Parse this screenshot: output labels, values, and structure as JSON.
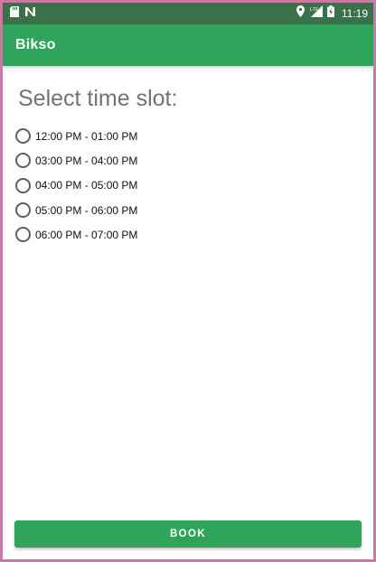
{
  "statusbar": {
    "time": "11:19",
    "network": "LTE",
    "left_icons": [
      "sd-card-icon",
      "n-notification-icon"
    ],
    "right_icons": [
      "location-icon",
      "signal-icon",
      "battery-icon"
    ]
  },
  "appbar": {
    "title": "Bikso"
  },
  "main": {
    "heading": "Select time slot:",
    "slots": [
      {
        "label": "12:00 PM - 01:00 PM",
        "selected": false
      },
      {
        "label": "03:00 PM - 04:00 PM",
        "selected": false
      },
      {
        "label": "04:00 PM - 05:00 PM",
        "selected": false
      },
      {
        "label": "05:00 PM - 06:00 PM",
        "selected": false
      },
      {
        "label": "06:00 PM - 07:00 PM",
        "selected": false
      }
    ]
  },
  "footer": {
    "book_label": "BOOK"
  },
  "colors": {
    "primary": "#2ea55a",
    "status_bar": "#3a7149",
    "heading_text": "#737373"
  }
}
